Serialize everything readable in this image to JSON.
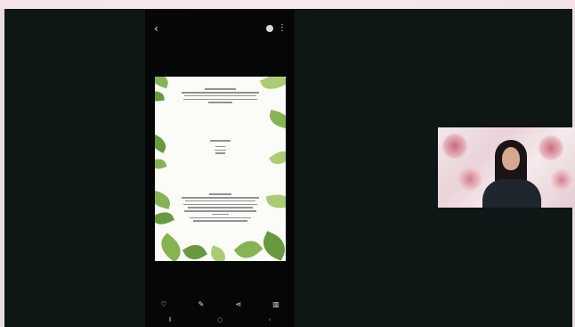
{
  "phone": {
    "status": {
      "time": "",
      "battery": ""
    },
    "toolbar_icons": [
      "back-icon",
      "cast-icon",
      "more-vertical-icon"
    ],
    "bottom_tools": [
      "lens-icon",
      "edit-icon",
      "share-icon",
      "delete-icon"
    ],
    "nav_buttons": [
      "recents-icon",
      "home-icon",
      "back-nav-icon"
    ]
  },
  "document": {
    "section1_title": "",
    "section2_title": "",
    "section3_title": ""
  },
  "colors": {
    "background": "#0e1616",
    "leaf_green": "#7fb04a",
    "paper": "#fbfbf7"
  }
}
